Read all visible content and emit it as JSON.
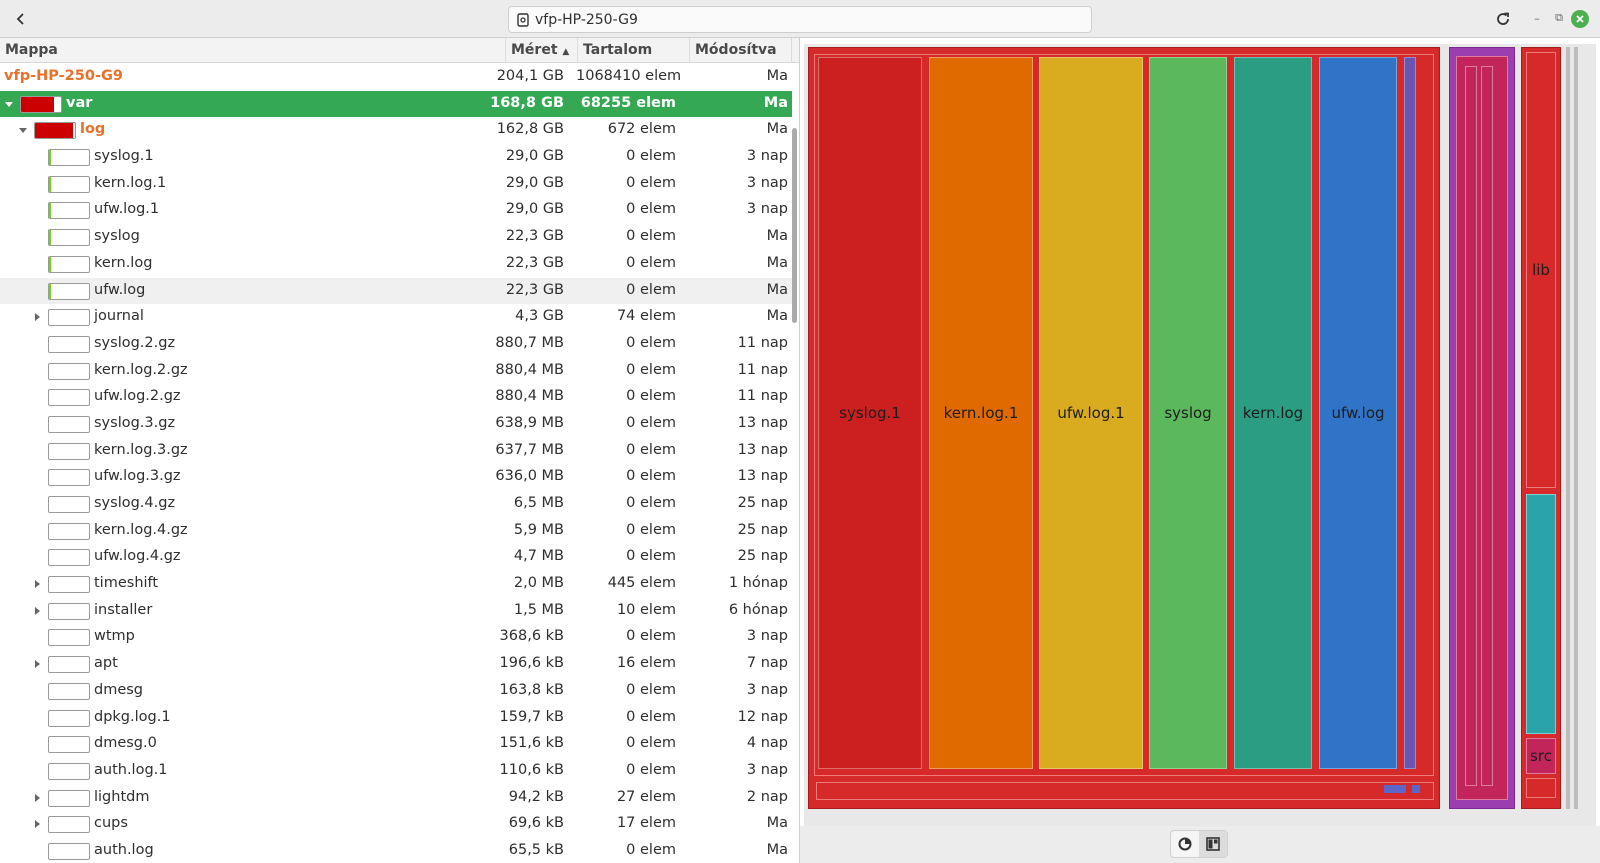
{
  "header": {
    "location": "vfp-HP-250-G9",
    "back_icon": "back-arrow-icon",
    "reload_icon": "reload-icon",
    "minimize": "–",
    "maximize": "⧉",
    "close": "✕"
  },
  "columns": {
    "folder": "Mappa",
    "size": "Méret",
    "contents": "Tartalom",
    "modified": "Módosítva"
  },
  "rows": [
    {
      "name": "vfp-HP-250-G9",
      "size": "204,1 GB",
      "count": "1068410 elem",
      "mod": "Ma",
      "level": 0,
      "type": "root"
    },
    {
      "name": "var",
      "size": "168,8 GB",
      "count": "68255 elem",
      "mod": "Ma",
      "level": 0,
      "type": "expanded",
      "fill": 0.83,
      "color": "#cc0000",
      "selected": true
    },
    {
      "name": "log",
      "size": "162,8 GB",
      "count": "672 elem",
      "mod": "Ma",
      "level": 1,
      "type": "expanded",
      "fill": 0.96,
      "color": "#cc0000"
    },
    {
      "name": "syslog.1",
      "size": "29,0 GB",
      "count": "0 elem",
      "mod": "3 nap",
      "level": 2,
      "type": "file",
      "fill": 0.06,
      "color": "#73d216"
    },
    {
      "name": "kern.log.1",
      "size": "29,0 GB",
      "count": "0 elem",
      "mod": "3 nap",
      "level": 2,
      "type": "file",
      "fill": 0.06,
      "color": "#73d216"
    },
    {
      "name": "ufw.log.1",
      "size": "29,0 GB",
      "count": "0 elem",
      "mod": "3 nap",
      "level": 2,
      "type": "file",
      "fill": 0.06,
      "color": "#73d216"
    },
    {
      "name": "syslog",
      "size": "22,3 GB",
      "count": "0 elem",
      "mod": "Ma",
      "level": 2,
      "type": "file",
      "fill": 0.05,
      "color": "#73d216"
    },
    {
      "name": "kern.log",
      "size": "22,3 GB",
      "count": "0 elem",
      "mod": "Ma",
      "level": 2,
      "type": "file",
      "fill": 0.05,
      "color": "#73d216"
    },
    {
      "name": "ufw.log",
      "size": "22,3 GB",
      "count": "0 elem",
      "mod": "Ma",
      "level": 2,
      "type": "file",
      "fill": 0.05,
      "color": "#73d216",
      "hover": true
    },
    {
      "name": "journal",
      "size": "4,3 GB",
      "count": "74 elem",
      "mod": "Ma",
      "level": 2,
      "type": "collapsed",
      "fill": 0,
      "color": "#73d216"
    },
    {
      "name": "syslog.2.gz",
      "size": "880,7 MB",
      "count": "0 elem",
      "mod": "11 nap",
      "level": 2,
      "type": "file",
      "fill": 0,
      "color": "#73d216"
    },
    {
      "name": "kern.log.2.gz",
      "size": "880,4 MB",
      "count": "0 elem",
      "mod": "11 nap",
      "level": 2,
      "type": "file",
      "fill": 0,
      "color": "#73d216"
    },
    {
      "name": "ufw.log.2.gz",
      "size": "880,4 MB",
      "count": "0 elem",
      "mod": "11 nap",
      "level": 2,
      "type": "file",
      "fill": 0,
      "color": "#73d216"
    },
    {
      "name": "syslog.3.gz",
      "size": "638,9 MB",
      "count": "0 elem",
      "mod": "13 nap",
      "level": 2,
      "type": "file",
      "fill": 0,
      "color": "#73d216"
    },
    {
      "name": "kern.log.3.gz",
      "size": "637,7 MB",
      "count": "0 elem",
      "mod": "13 nap",
      "level": 2,
      "type": "file",
      "fill": 0,
      "color": "#73d216"
    },
    {
      "name": "ufw.log.3.gz",
      "size": "636,0 MB",
      "count": "0 elem",
      "mod": "13 nap",
      "level": 2,
      "type": "file",
      "fill": 0,
      "color": "#73d216"
    },
    {
      "name": "syslog.4.gz",
      "size": "6,5 MB",
      "count": "0 elem",
      "mod": "25 nap",
      "level": 2,
      "type": "file",
      "fill": 0,
      "color": "#73d216"
    },
    {
      "name": "kern.log.4.gz",
      "size": "5,9 MB",
      "count": "0 elem",
      "mod": "25 nap",
      "level": 2,
      "type": "file",
      "fill": 0,
      "color": "#73d216"
    },
    {
      "name": "ufw.log.4.gz",
      "size": "4,7 MB",
      "count": "0 elem",
      "mod": "25 nap",
      "level": 2,
      "type": "file",
      "fill": 0,
      "color": "#73d216"
    },
    {
      "name": "timeshift",
      "size": "2,0 MB",
      "count": "445 elem",
      "mod": "1 hónap",
      "level": 2,
      "type": "collapsed",
      "fill": 0,
      "color": "#73d216"
    },
    {
      "name": "installer",
      "size": "1,5 MB",
      "count": "10 elem",
      "mod": "6 hónap",
      "level": 2,
      "type": "collapsed",
      "fill": 0,
      "color": "#73d216"
    },
    {
      "name": "wtmp",
      "size": "368,6 kB",
      "count": "0 elem",
      "mod": "3 nap",
      "level": 2,
      "type": "file",
      "fill": 0,
      "color": "#73d216"
    },
    {
      "name": "apt",
      "size": "196,6 kB",
      "count": "16 elem",
      "mod": "7 nap",
      "level": 2,
      "type": "collapsed",
      "fill": 0,
      "color": "#73d216"
    },
    {
      "name": "dmesg",
      "size": "163,8 kB",
      "count": "0 elem",
      "mod": "3 nap",
      "level": 2,
      "type": "file",
      "fill": 0,
      "color": "#73d216"
    },
    {
      "name": "dpkg.log.1",
      "size": "159,7 kB",
      "count": "0 elem",
      "mod": "12 nap",
      "level": 2,
      "type": "file",
      "fill": 0,
      "color": "#73d216"
    },
    {
      "name": "dmesg.0",
      "size": "151,6 kB",
      "count": "0 elem",
      "mod": "4 nap",
      "level": 2,
      "type": "file",
      "fill": 0,
      "color": "#73d216"
    },
    {
      "name": "auth.log.1",
      "size": "110,6 kB",
      "count": "0 elem",
      "mod": "3 nap",
      "level": 2,
      "type": "file",
      "fill": 0,
      "color": "#73d216"
    },
    {
      "name": "lightdm",
      "size": "94,2 kB",
      "count": "27 elem",
      "mod": "2 nap",
      "level": 2,
      "type": "collapsed",
      "fill": 0,
      "color": "#73d216"
    },
    {
      "name": "cups",
      "size": "69,6 kB",
      "count": "17 elem",
      "mod": "Ma",
      "level": 2,
      "type": "collapsed",
      "fill": 0,
      "color": "#73d216"
    },
    {
      "name": "auth.log",
      "size": "65,5 kB",
      "count": "0 elem",
      "mod": "Ma",
      "level": 2,
      "type": "file",
      "fill": 0,
      "color": "#73d216"
    }
  ],
  "treemap": {
    "labels": [
      "syslog.1",
      "kern.log.1",
      "ufw.log.1",
      "syslog",
      "kern.log",
      "ufw.log",
      "lib",
      "src"
    ],
    "colors": [
      "#cc2020",
      "#e06a00",
      "#d9ab1f",
      "#5cb85c",
      "#2a9d82",
      "#2f74c7"
    ]
  },
  "view_buttons": [
    "ring-chart-icon",
    "treemap-icon"
  ]
}
